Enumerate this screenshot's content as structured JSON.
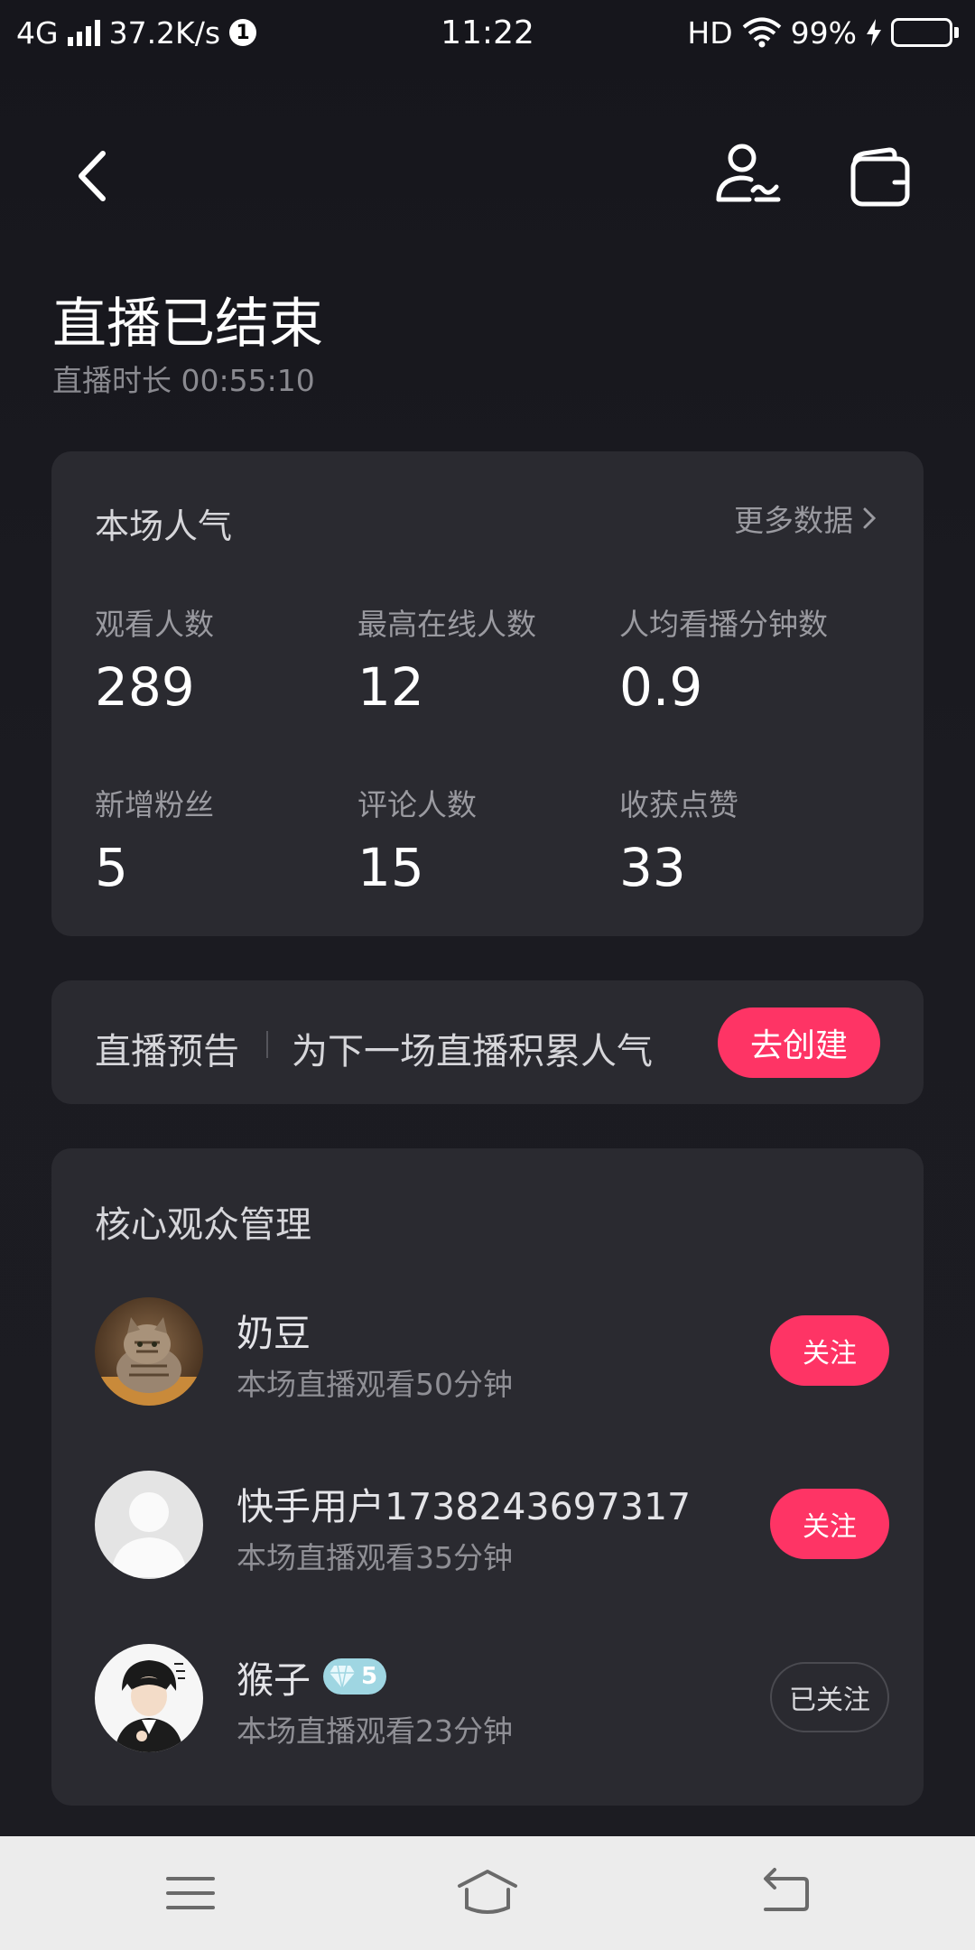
{
  "status_bar": {
    "network": "4G",
    "speed": "37.2K/s",
    "notification_count": "1",
    "time": "11:22",
    "hd": "HD",
    "battery": "99%"
  },
  "page": {
    "title": "直播已结束",
    "duration": "直播时长 00:55:10"
  },
  "stats": {
    "title": "本场人气",
    "more_label": "更多数据",
    "items": [
      {
        "label": "观看人数",
        "value": "289"
      },
      {
        "label": "最高在线人数",
        "value": "12"
      },
      {
        "label": "人均看播分钟数",
        "value": "0.9"
      },
      {
        "label": "新增粉丝",
        "value": "5"
      },
      {
        "label": "评论人数",
        "value": "15"
      },
      {
        "label": "收获点赞",
        "value": "33"
      }
    ]
  },
  "preview": {
    "title": "直播预告",
    "description": "为下一场直播积累人气",
    "button": "去创建"
  },
  "audience": {
    "title": "核心观众管理",
    "viewers": [
      {
        "name": "奶豆",
        "watch": "本场直播观看50分钟",
        "action": "关注"
      },
      {
        "name": "快手用户1738243697317",
        "watch": "本场直播观看35分钟",
        "action": "关注"
      },
      {
        "name": "猴子",
        "badge_level": "5",
        "watch": "本场直播观看23分钟",
        "action": "已关注"
      }
    ]
  },
  "colors": {
    "accent": "#fe3465",
    "card_bg": "#2a2a30",
    "page_bg": "#1b1b21"
  }
}
